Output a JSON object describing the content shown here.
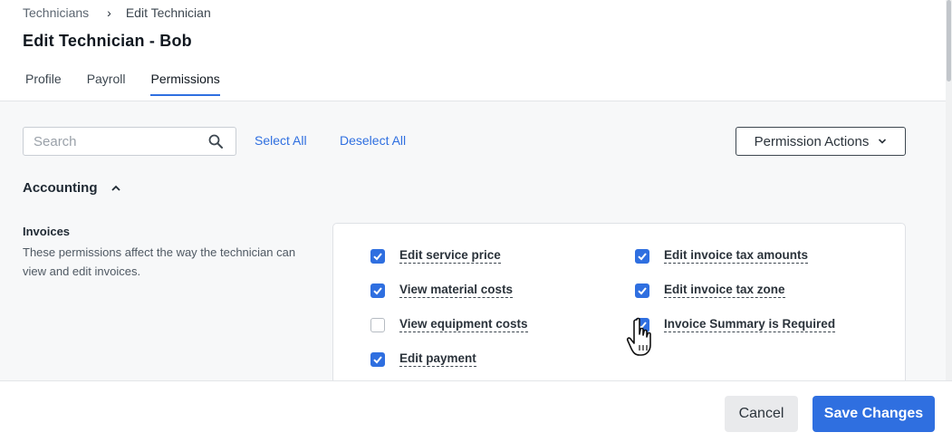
{
  "breadcrumb": {
    "parent": "Technicians",
    "separator": "›",
    "current": "Edit Technician"
  },
  "page_title": "Edit Technician - Bob",
  "tabs": [
    {
      "label": "Profile",
      "active": false
    },
    {
      "label": "Payroll",
      "active": false
    },
    {
      "label": "Permissions",
      "active": true
    }
  ],
  "toolbar": {
    "search_placeholder": "Search",
    "select_all": "Select All",
    "deselect_all": "Deselect All",
    "permission_actions": "Permission Actions"
  },
  "section": {
    "title": "Accounting",
    "expanded": true,
    "group": {
      "title": "Invoices",
      "description": "These permissions affect the way the technician can view and edit invoices.",
      "permissions": [
        {
          "label": "Edit service price",
          "checked": true
        },
        {
          "label": "View material costs",
          "checked": true
        },
        {
          "label": "View equipment costs",
          "checked": false
        },
        {
          "label": "Edit payment",
          "checked": true
        },
        {
          "label": "Edit invoice tax amounts",
          "checked": true
        },
        {
          "label": "Edit invoice tax zone",
          "checked": true
        },
        {
          "label": "Invoice Summary is Required",
          "checked": true
        }
      ]
    }
  },
  "footer": {
    "cancel_label": "Cancel",
    "save_label": "Save Changes"
  },
  "colors": {
    "accent": "#2f6fe0",
    "cancel_bg": "#e9eaec",
    "content_bg": "#f7f8f9"
  }
}
